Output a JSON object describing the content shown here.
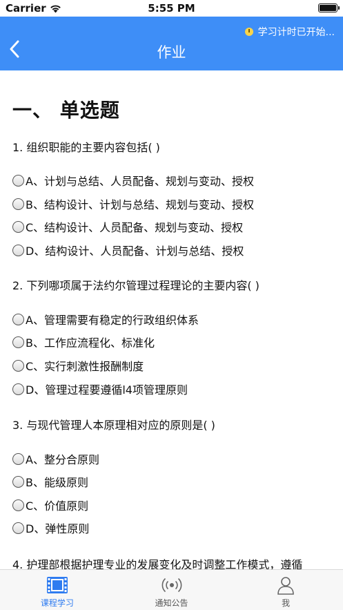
{
  "status_bar": {
    "carrier": "Carrier",
    "time": "5:55 PM"
  },
  "nav": {
    "title": "作业",
    "timer_text": "学习计时已开始..."
  },
  "section_title": "一、 单选题",
  "questions": [
    {
      "text": "1. 组织职能的主要内容包括( )",
      "options": [
        "A、计划与总结、人员配备、规划与变动、授权",
        "B、结构设计、计划与总结、规划与变动、授权",
        "C、结构设计、人员配备、规划与变动、授权",
        "D、结构设计、人员配备、计划与总结、授权"
      ]
    },
    {
      "text": "2. 下列哪项属于法约尔管理过程理论的主要内容( )",
      "options": [
        "A、管理需要有稳定的行政组织体系",
        "B、工作应流程化、标准化",
        "C、实行刺激性报酬制度",
        "D、管理过程要遵循l4项管理原则"
      ]
    },
    {
      "text": "3. 与现代管理人本原理相对应的原则是( )",
      "options": [
        "A、整分合原则",
        "B、能级原则",
        "C、价值原则",
        "D、弹性原则"
      ]
    },
    {
      "text": "4. 护理部根据护理专业的发展变化及时调整工作模式，遵循",
      "options": []
    }
  ],
  "tab_bar": {
    "tabs": [
      {
        "label": "课程学习",
        "icon": "film-icon"
      },
      {
        "label": "通知公告",
        "icon": "broadcast-icon"
      },
      {
        "label": "我",
        "icon": "person-icon"
      }
    ],
    "active_color": "#2f7cf0"
  },
  "colors": {
    "nav_background": "#3e8ef7",
    "timer_icon": "#f8d44a"
  }
}
